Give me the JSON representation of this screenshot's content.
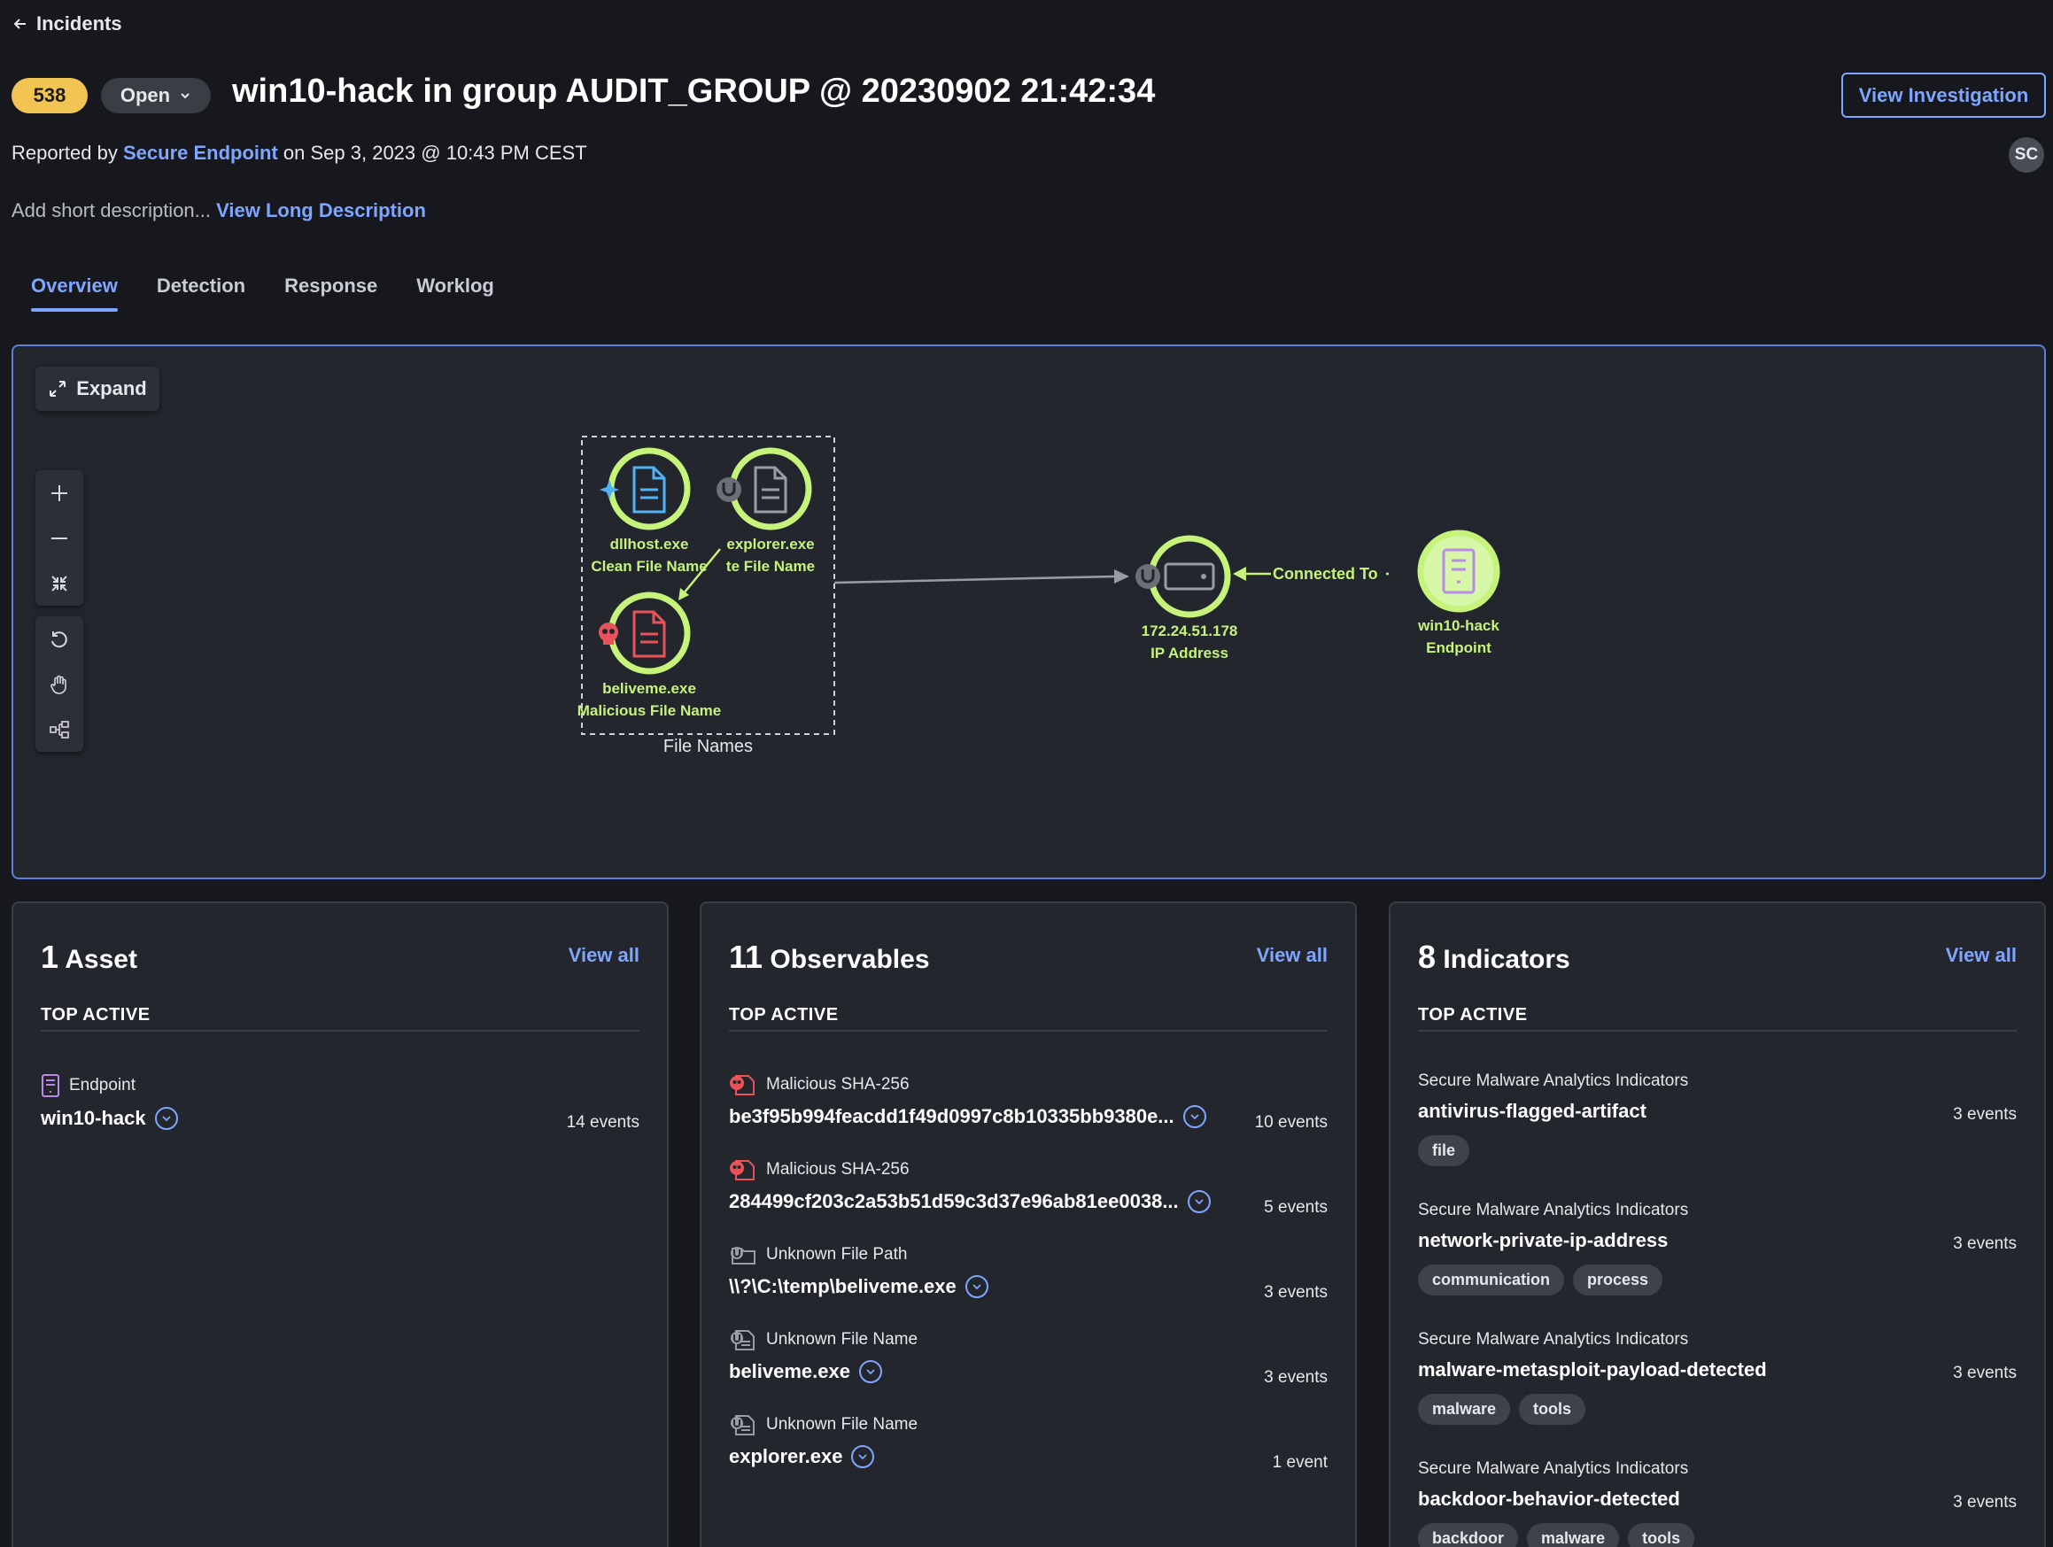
{
  "header": {
    "back_label": "Incidents",
    "incident_number": "538",
    "status": "Open",
    "title": "win10-hack in group AUDIT_GROUP @ 20230902 21:42:34",
    "view_investigation": "View Investigation",
    "avatar_initials": "SC",
    "reported_prefix": "Reported by",
    "reporter": "Secure Endpoint",
    "reported_suffix": "on Sep 3, 2023 @ 10:43 PM CEST",
    "description_placeholder": "Add short description...",
    "view_long_description": "View Long Description"
  },
  "tabs": [
    {
      "label": "Overview",
      "active": true
    },
    {
      "label": "Detection",
      "active": false
    },
    {
      "label": "Response",
      "active": false
    },
    {
      "label": "Worklog",
      "active": false
    }
  ],
  "graph": {
    "expand_label": "Expand",
    "group_label": "File Names",
    "nodes": {
      "dllhost": {
        "name": "dllhost.exe",
        "type": "Clean File Name",
        "color": "#4fb3f6"
      },
      "explorer": {
        "name": "explorer.exe",
        "type": "te File Name",
        "color": "#9a9ca3"
      },
      "beliveme": {
        "name": "beliveme.exe",
        "type": "Malicious File Name",
        "color": "#e8535a"
      },
      "ip": {
        "name": "172.24.51.178",
        "type": "IP Address",
        "color": "#9a9ca3"
      },
      "endpoint": {
        "name": "win10-hack",
        "type": "Endpoint",
        "color": "#b98ae8"
      }
    },
    "edge_label": "Connected To",
    "accent": "#c6f37a"
  },
  "cards": {
    "assets": {
      "count": "1",
      "title": "Asset",
      "view_all": "View all",
      "subtitle": "TOP ACTIVE",
      "items": [
        {
          "kind": "Endpoint",
          "value": "win10-hack",
          "events": "14 events"
        }
      ]
    },
    "observables": {
      "count": "11",
      "title": "Observables",
      "view_all": "View all",
      "subtitle": "TOP ACTIVE",
      "items": [
        {
          "kind": "Malicious SHA-256",
          "value": "be3f95b994feacdd1f49d0997c8b10335bb9380e...",
          "events": "10 events",
          "icon": "malicious-hash-icon"
        },
        {
          "kind": "Malicious SHA-256",
          "value": "284499cf203c2a53b51d59c3d37e96ab81ee0038...",
          "events": "5 events",
          "icon": "malicious-hash-icon"
        },
        {
          "kind": "Unknown File Path",
          "value": "\\\\?\\C:\\temp\\beliveme.exe",
          "events": "3 events",
          "icon": "unknown-file-path-icon"
        },
        {
          "kind": "Unknown File Name",
          "value": "beliveme.exe",
          "events": "3 events",
          "icon": "unknown-file-name-icon"
        },
        {
          "kind": "Unknown File Name",
          "value": "explorer.exe",
          "events": "1 event",
          "icon": "unknown-file-name-icon"
        }
      ]
    },
    "indicators": {
      "count": "8",
      "title": "Indicators",
      "view_all": "View all",
      "subtitle": "TOP ACTIVE",
      "items": [
        {
          "source": "Secure Malware Analytics Indicators",
          "name": "antivirus-flagged-artifact",
          "events": "3 events",
          "tags": [
            "file"
          ]
        },
        {
          "source": "Secure Malware Analytics Indicators",
          "name": "network-private-ip-address",
          "events": "3 events",
          "tags": [
            "communication",
            "process"
          ]
        },
        {
          "source": "Secure Malware Analytics Indicators",
          "name": "malware-metasploit-payload-detected",
          "events": "3 events",
          "tags": [
            "malware",
            "tools"
          ]
        },
        {
          "source": "Secure Malware Analytics Indicators",
          "name": "backdoor-behavior-detected",
          "events": "3 events",
          "tags": [
            "backdoor",
            "malware",
            "tools"
          ]
        }
      ]
    }
  }
}
